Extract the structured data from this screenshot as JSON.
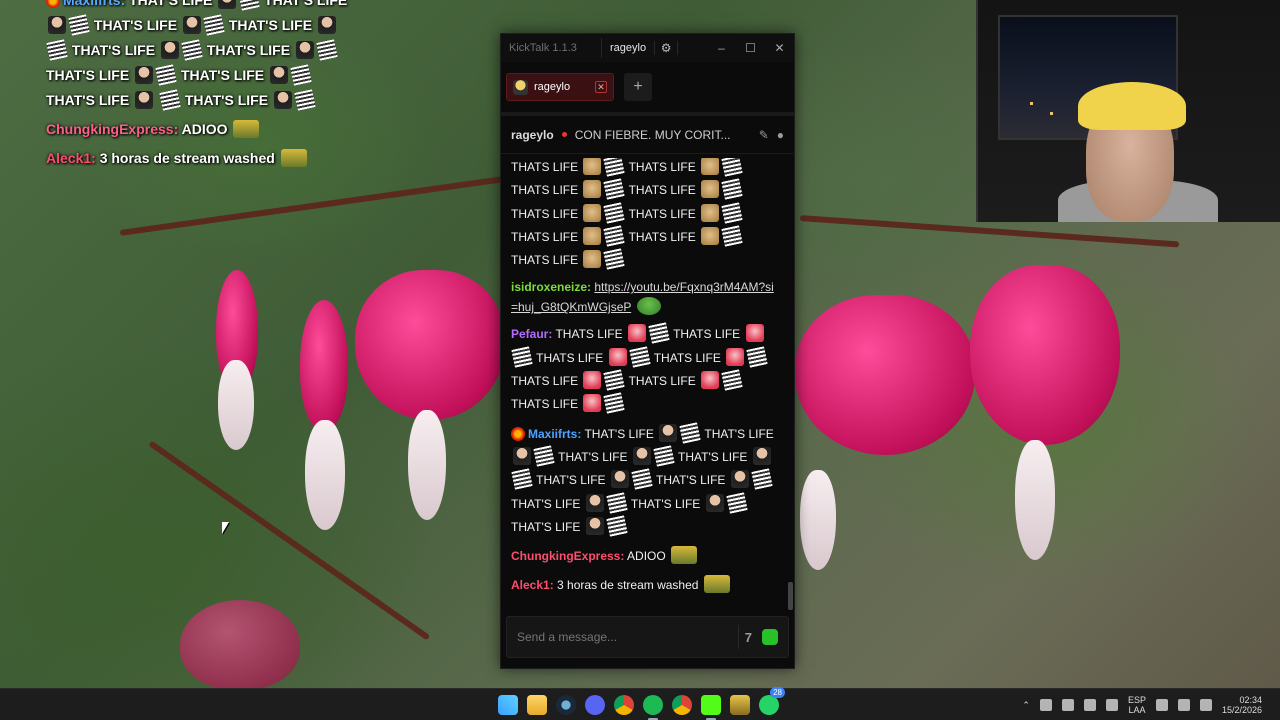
{
  "overlay_chat": {
    "line0_name": "Maxiifrts:",
    "line0_text": " THAT'S LIFE",
    "line0_text2": " THAT'S LIFE",
    "rows": [
      "THAT'S LIFE",
      "THAT'S LIFE",
      "THAT'S LIFE",
      "THAT'S LIFE",
      "THAT'S LIFE",
      "THAT'S",
      "LIFE",
      "THAT'S LIFE",
      "THAT'S LIFE"
    ],
    "chungking_name": "ChungkingExpress:",
    "chungking_text": " ADIOO",
    "aleck_name": "Aleck1:",
    "aleck_text": " 3 horas de stream washed"
  },
  "window": {
    "app_title": "KickTalk 1.1.3",
    "titlebar_user": "rageylo",
    "tab_label": "rageylo",
    "chat_user": "rageylo",
    "chat_title": "CON FIEBRE. MUY CORIT...",
    "input_placeholder": "Send a message..."
  },
  "messages": {
    "thats_life": "THATS LIFE",
    "that_s_life": "THAT'S LIFE",
    "that_s": "THAT'S",
    "life": "LIFE",
    "isidro_name": "isidroxeneize:",
    "isidro_link": "https://youtu.be/Fqxnq3rM4AM?si=huj_G8tQKmWGjseP",
    "pefaur_name": "Pefaur:",
    "maxi_name": "Maxiifrts:",
    "chungking_name": "ChungkingExpress:",
    "chungking_text": "ADIOO",
    "aleck_name": "Aleck1:",
    "aleck_text": "3 horas de stream washed"
  },
  "taskbar": {
    "lang_top": "ESP",
    "lang_bottom": "LAA",
    "time": "02:34",
    "date": "15/2/2026",
    "whatsapp_badge": "28"
  },
  "colors": {
    "accent_kick": "#53fc18",
    "tab_bg": "#3a1012"
  }
}
